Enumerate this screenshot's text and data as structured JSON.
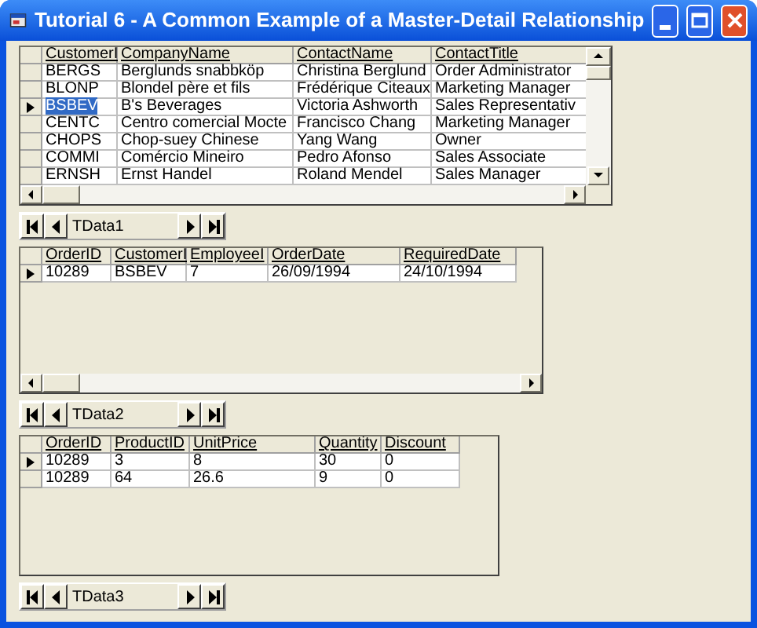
{
  "window": {
    "title": "Tutorial 6 - A Common Example of a Master-Detail Relationship"
  },
  "grids": [
    {
      "columns": [
        "CustomerI",
        "CompanyName",
        "ContactName",
        "ContactTitle"
      ],
      "vertical_scrollbar": true,
      "horizontal_scrollbar": true,
      "rows": [
        {
          "current": false,
          "cell_selected": false,
          "cells": [
            "BERGS",
            "Berglunds snabbköp",
            "Christina Berglund",
            "Order Administrator"
          ]
        },
        {
          "current": false,
          "cell_selected": false,
          "cells": [
            "BLONP",
            "Blondel père et fils",
            "Frédérique Citeaux",
            "Marketing Manager"
          ]
        },
        {
          "current": true,
          "cell_selected": true,
          "cells": [
            "BSBEV",
            "B's Beverages",
            "Victoria Ashworth",
            "Sales Representativ"
          ]
        },
        {
          "current": false,
          "cell_selected": false,
          "cells": [
            "CENTC",
            "Centro comercial Mocte",
            "Francisco Chang",
            "Marketing Manager"
          ]
        },
        {
          "current": false,
          "cell_selected": false,
          "cells": [
            "CHOPS",
            "Chop-suey Chinese",
            "Yang Wang",
            "Owner"
          ]
        },
        {
          "current": false,
          "cell_selected": false,
          "cells": [
            "COMMI",
            "Comércio Mineiro",
            "Pedro Afonso",
            "Sales Associate"
          ]
        },
        {
          "current": false,
          "cell_selected": false,
          "cells": [
            "ERNSH",
            "Ernst Handel",
            "Roland Mendel",
            "Sales Manager"
          ]
        }
      ],
      "navigator": {
        "caption": "TData1"
      }
    },
    {
      "columns": [
        "OrderID",
        "CustomerI",
        "EmployeeI",
        "OrderDate",
        "RequiredDate"
      ],
      "vertical_scrollbar": false,
      "horizontal_scrollbar": true,
      "rows": [
        {
          "current": true,
          "cell_selected": false,
          "cells": [
            "10289",
            "BSBEV",
            "7",
            "26/09/1994",
            "24/10/1994"
          ]
        }
      ],
      "navigator": {
        "caption": "TData2"
      }
    },
    {
      "columns": [
        "OrderID",
        "ProductID",
        "UnitPrice",
        "Quantity",
        "Discount"
      ],
      "vertical_scrollbar": false,
      "horizontal_scrollbar": false,
      "rows": [
        {
          "current": true,
          "cell_selected": false,
          "cells": [
            "10289",
            "3",
            "8",
            "30",
            "0"
          ]
        },
        {
          "current": false,
          "cell_selected": false,
          "cells": [
            "10289",
            "64",
            "26.6",
            "9",
            "0"
          ]
        }
      ],
      "navigator": {
        "caption": "TData3"
      }
    }
  ]
}
